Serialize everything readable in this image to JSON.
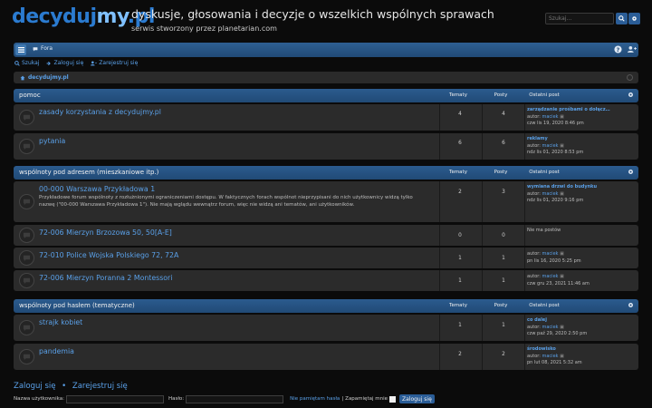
{
  "header": {
    "logo_main": "decydujmy",
    "logo_suffix": ".pl",
    "logo_my": "my",
    "logo_pre": "decyduj",
    "title": "dyskusje, głosowania i decyzje o wszelkich wspólnych sprawach",
    "subtitle": "serwis stworzony przez planetarian.com",
    "search_placeholder": "Szukaj…"
  },
  "nav": {
    "forum_label": "Fora",
    "links": {
      "search": "Szukaj",
      "login": "Zaloguj się",
      "register": "Zarejestruj się"
    },
    "breadcrumb": "decydujmy.pl"
  },
  "columns": {
    "topics": "Tematy",
    "posts": "Posty",
    "last": "Ostatni post"
  },
  "categories": [
    {
      "title": "pomoc",
      "forums": [
        {
          "name": "zasady korzystania z decydujmy.pl",
          "topics": "4",
          "posts": "4",
          "last_title": "zarządzanie prośbami o dołącz…",
          "author_prefix": "autor:",
          "author": "maciek",
          "date": "czw lis 19, 2020 8:46 pm"
        },
        {
          "name": "pytania",
          "topics": "6",
          "posts": "6",
          "last_title": "reklamy",
          "author_prefix": "autor:",
          "author": "maciek",
          "date": "ndz lis 01, 2020 8:53 pm"
        }
      ]
    },
    {
      "title": "wspólnoty pod adresem (mieszkaniowe itp.)",
      "forums": [
        {
          "name": "00-000 Warszawa Przykładowa 1",
          "desc": "Przykładowe forum wspólnoty z rozłużnionymi ograniczeniami dostępu. W faktycznych forach wspólnot nieprzypisani do nich użytkownicy widzą tylko nazwę (\"00-000 Warszawa Przykładowa 1\"). Nie mają wglądu wewnątrz forum, więc nie widzą ani tematów, ani użytkowników.",
          "topics": "2",
          "posts": "3",
          "last_title": "wymiana drzwi do budynku",
          "author_prefix": "autor:",
          "author": "maciek",
          "date": "ndz lis 01, 2020 9:16 pm"
        },
        {
          "name": "72-006 Mierzyn Brzozowa 50, 50[A-E]",
          "topics": "0",
          "posts": "0",
          "empty": "Nie ma postów"
        },
        {
          "name": "72-010 Police Wojska Polskiego 72, 72A",
          "topics": "1",
          "posts": "1",
          "last_title": "",
          "author_prefix": "autor:",
          "author": "maciek",
          "date": "pn lis 16, 2020 5:25 pm"
        },
        {
          "name": "72-006 Mierzyn Poranna 2 Montessori",
          "topics": "1",
          "posts": "1",
          "last_title": "",
          "author_prefix": "autor:",
          "author": "maciek",
          "date": "czw gru 23, 2021 11:46 am"
        }
      ]
    },
    {
      "title": "wspólnoty pod hasłem (tematyczne)",
      "forums": [
        {
          "name": "strajk kobiet",
          "topics": "1",
          "posts": "1",
          "last_title": "co dalej",
          "author_prefix": "autor:",
          "author": "maciek",
          "date": "czw paź 29, 2020 2:50 pm"
        },
        {
          "name": "pandemia",
          "topics": "2",
          "posts": "2",
          "last_title": "środowisko",
          "author_prefix": "autor:",
          "author": "maciek",
          "date": "pn lut 08, 2021 5:32 am"
        }
      ]
    }
  ],
  "login": {
    "heading_login": "Zaloguj się",
    "heading_sep": "•",
    "heading_register": "Zarejestruj się",
    "username_label": "Nazwa użytkownika:",
    "password_label": "Hasło:",
    "forgot": "Nie pamiętam hasła",
    "sep": "|",
    "remember": "Zapamiętaj mnie",
    "button": "Zaloguj się"
  },
  "colors": {
    "accent": "#2a5d97",
    "link": "#5aa0e8",
    "row_bg": "#2b2b2b",
    "page_bg": "#0b0b0b"
  },
  "icons": {
    "search": "search-icon",
    "gear": "gear-icon",
    "help": "question-icon",
    "user_add": "user-add-icon",
    "home": "home-icon",
    "forum": "forum-bubble-icon",
    "menu": "hamburger-icon"
  }
}
